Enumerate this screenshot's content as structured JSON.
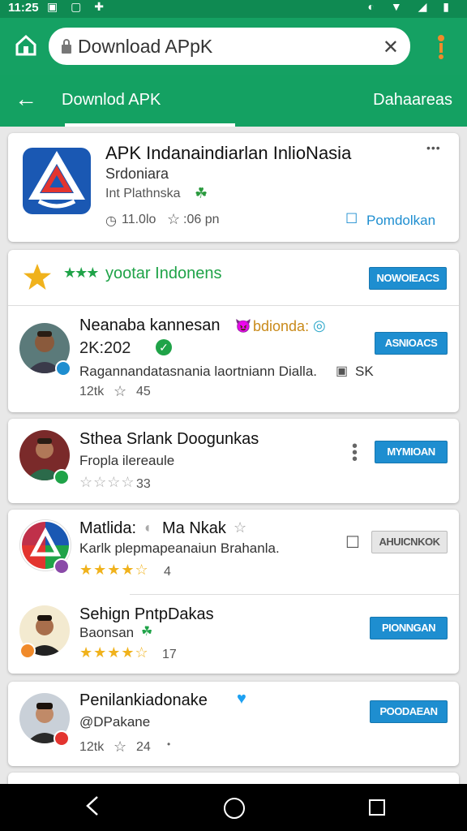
{
  "status_bar": {
    "time": "11:25",
    "left_icons": "▣ ▢ ✚",
    "right_icons": "◐ ▼ ◢ ▮"
  },
  "browser": {
    "url": "Download  APpK",
    "clear_glyph": "✕"
  },
  "app_bar": {
    "back_glyph": "←",
    "title": "Downlod APK",
    "right_label": "Dahaareas"
  },
  "featured": {
    "title": "APK Indanaindiarlan InlioNasia",
    "subtitle": "Srdoniara",
    "meta": "Int Plathnska",
    "size": "11.0lo",
    "time": ":06 pn",
    "action": "Pomdolkan",
    "more_glyph": "•••"
  },
  "rating_card": {
    "stars_label": "★★★",
    "label": "yootar Indonens",
    "button": "NOWOIEACS",
    "user": {
      "name": "Neanaba kannesan",
      "tag": "bdionda:",
      "handle": "2K:202",
      "text": "Ragannandatasnania laortniann Dialla.",
      "extra": "SK",
      "count_prefix": "12tk",
      "count": "45",
      "button": "ASNIOACS"
    }
  },
  "list": [
    {
      "name": "Sthea Srlank Doogunkas",
      "sub": "Fropla ilereaule",
      "stars": "☆☆☆☆",
      "count": "33",
      "button": "MYMIOAN"
    },
    {
      "name": "Matlida:",
      "name2": "Ma Nkak",
      "sub": "Karlk plepmapeanaiun Brahanla.",
      "stars": "★★★★☆",
      "count": "4",
      "button": "AHUICNKOK"
    },
    {
      "name": "Sehign PntpDakas",
      "sub": "Baonsan",
      "stars": "★★★★☆",
      "count": "17",
      "button": "PIONNGAN"
    },
    {
      "name": "Penilankiadonake",
      "sub": "@DPakane",
      "count_prefix": "12tk",
      "count": "24",
      "button": "POODAEAN"
    }
  ],
  "colors": {
    "brand_green": "#15a163",
    "button_blue": "#1e8ed0",
    "star_gold": "#f0b21c"
  }
}
